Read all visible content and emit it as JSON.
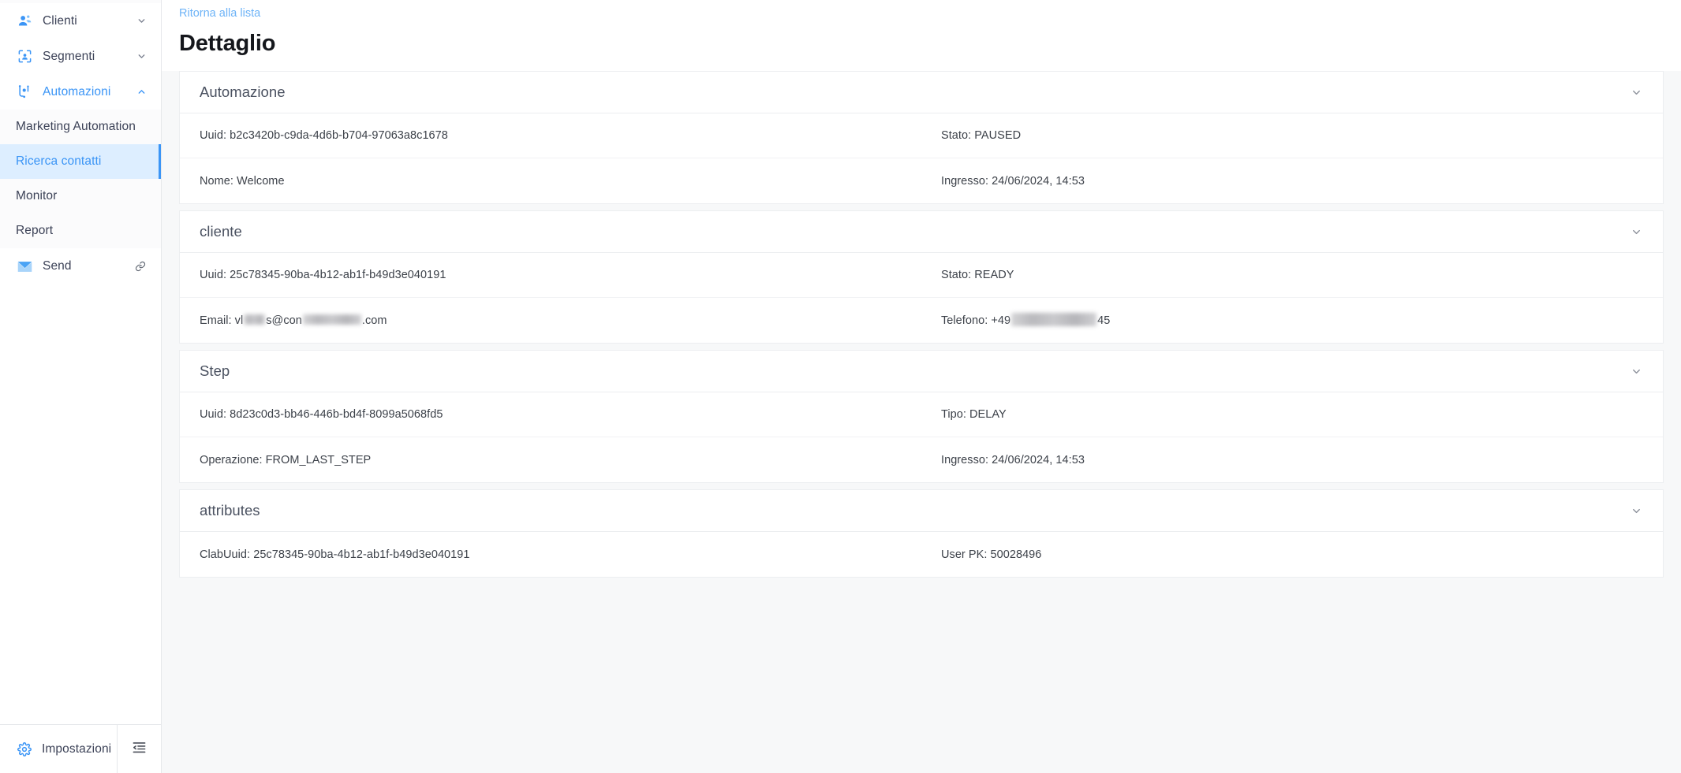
{
  "sidebar": {
    "groups": [
      {
        "label": "Clienti",
        "icon": "users-icon",
        "expanded": false,
        "chevron": "chevron-down-icon"
      },
      {
        "label": "Segmenti",
        "icon": "segment-icon",
        "expanded": false,
        "chevron": "chevron-down-icon"
      },
      {
        "label": "Automazioni",
        "icon": "automation-icon",
        "expanded": true,
        "chevron": "chevron-up-icon"
      }
    ],
    "automazioni_items": [
      {
        "label": "Marketing Automation",
        "selected": false
      },
      {
        "label": "Ricerca contatti",
        "selected": true
      },
      {
        "label": "Monitor",
        "selected": false
      },
      {
        "label": "Report",
        "selected": false
      }
    ],
    "send": {
      "label": "Send",
      "icon": "envelope-icon",
      "external_icon": "link-icon"
    },
    "footer": {
      "settings_label": "Impostazioni",
      "settings_icon": "gear-icon",
      "collapse_icon": "collapse-sidebar-icon"
    },
    "accent_color": "#3b95f6",
    "selected_bg": "#ddeeff"
  },
  "header": {
    "back_link": "Ritorna alla lista",
    "title": "Dettaglio",
    "link_color": "#6db3f7"
  },
  "cards": [
    {
      "title": "Automazione",
      "chevron": "chevron-down-icon",
      "rows": [
        {
          "left": "Uuid: b2c3420b-c9da-4d6b-b704-97063a8c1678",
          "right": "Stato: PAUSED"
        },
        {
          "left": "Nome: Welcome",
          "right": "Ingresso: 24/06/2024, 14:53"
        }
      ]
    },
    {
      "title": "cliente",
      "chevron": "chevron-down-icon",
      "rows": [
        {
          "left": "Uuid: 25c78345-90ba-4b12-ab1f-b49d3e040191",
          "right": "Stato: READY"
        },
        {
          "left": "Email: ",
          "left_redacted": true,
          "right": "Telefono: ",
          "right_redacted": true,
          "email_prefix": "Email: vl",
          "email_mid": "s@con",
          "email_suffix": ".com",
          "phone_prefix": "Telefono: +49",
          "phone_suffix": "45"
        }
      ]
    },
    {
      "title": "Step",
      "chevron": "chevron-down-icon",
      "rows": [
        {
          "left": "Uuid: 8d23c0d3-bb46-446b-bd4f-8099a5068fd5",
          "right": "Tipo: DELAY"
        },
        {
          "left": "Operazione: FROM_LAST_STEP",
          "right": "Ingresso: 24/06/2024, 14:53"
        }
      ]
    },
    {
      "title": "attributes",
      "chevron": "chevron-down-icon",
      "rows": [
        {
          "left": "ClabUuid: 25c78345-90ba-4b12-ab1f-b49d3e040191",
          "right": "User PK: 50028496"
        }
      ]
    }
  ]
}
